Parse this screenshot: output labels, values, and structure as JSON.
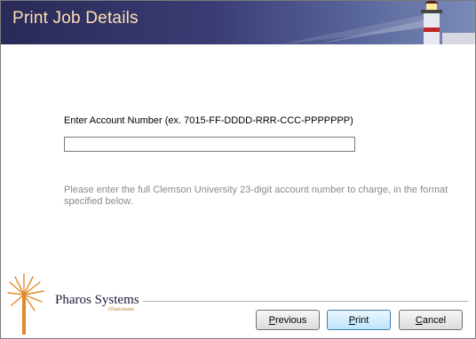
{
  "window": {
    "title": "Print Job Details"
  },
  "form": {
    "account_label": "Enter Account Number (ex. 7015-FF-DDDD-RRR-CCC-PPPPPPP)",
    "account_value": "",
    "help_text": "Please enter the full Clemson University 23-digit account number to charge, in the format specified below."
  },
  "branding": {
    "name": "Pharos Systems",
    "tagline": "illuminate"
  },
  "buttons": {
    "previous": {
      "mnemonic": "P",
      "rest": "revious"
    },
    "print": {
      "mnemonic": "P",
      "rest": "rint"
    },
    "cancel": {
      "mnemonic": "C",
      "rest": "ancel"
    }
  },
  "colors": {
    "header_dark": "#2a2a58",
    "header_light": "#7b8bb8",
    "title_text": "#ffe0b0",
    "brand_orange": "#c0781a"
  }
}
